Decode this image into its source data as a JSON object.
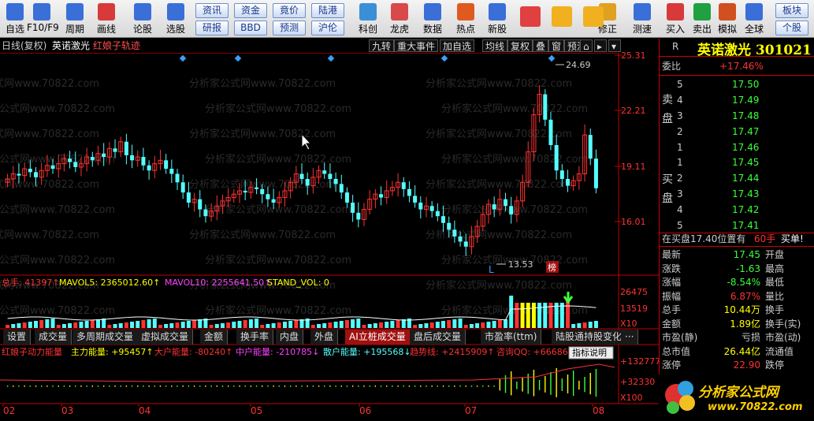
{
  "toolbar": {
    "buttons": [
      {
        "label": "自选",
        "icon": "watchlist-icon"
      },
      {
        "label": "F10/F9",
        "icon": "f10-icon"
      },
      {
        "label": "周期",
        "icon": "cycle-icon"
      },
      {
        "label": "画线",
        "icon": "draw-line-icon"
      },
      {
        "label": "论股",
        "icon": "forum-icon"
      },
      {
        "label": "选股",
        "icon": "stock-picker-icon"
      },
      {
        "label": "科创",
        "icon": "sci-tech-icon"
      },
      {
        "label": "龙虎",
        "icon": "dragon-tiger-icon"
      },
      {
        "label": "数据",
        "icon": "data-icon"
      },
      {
        "label": "热点",
        "icon": "hotspot-icon"
      },
      {
        "label": "新股",
        "icon": "ipo-icon"
      },
      {
        "label": "修正",
        "icon": "revise-icon"
      },
      {
        "label": "测速",
        "icon": "speed-test-icon"
      },
      {
        "label": "买入",
        "icon": "buy-icon"
      },
      {
        "label": "卖出",
        "icon": "sell-icon"
      },
      {
        "label": "模拟",
        "icon": "simulate-icon"
      },
      {
        "label": "全球",
        "icon": "global-icon"
      }
    ],
    "small_buttons": [
      "资讯",
      "资金",
      "竟价",
      "陆港",
      "研报",
      "BBD",
      "预测",
      "沪伦"
    ],
    "right_buttons": [
      "板块",
      "个股"
    ]
  },
  "chart_header": {
    "title": "日线(复权)",
    "stock_name": "英诺激光",
    "indicator": "红娘子轨迹",
    "buttons": [
      "九转",
      "重大事件",
      "加自选",
      "均线",
      "复权",
      "叠",
      "窗",
      "预测"
    ]
  },
  "price_axis": [
    "25.31",
    "22.21",
    "19.11",
    "16.01"
  ],
  "annotations": {
    "high": "24.69",
    "low": "13.53",
    "low_mark": "L",
    "badge": "榜"
  },
  "volume_header": {
    "total": "总手: 41397↑",
    "mavol5": "MAVOL5: 2365012.60↑",
    "mavol10": "MAVOL10: 2255641.50↑",
    "stand": "STAND_VOL: 0"
  },
  "volume_axis": [
    "26475",
    "13519",
    "X10"
  ],
  "tabs": [
    "设置",
    "成交量",
    "多周期成交量",
    "虚拟成交量",
    "金额",
    "换手率",
    "内盘",
    "外盘",
    "AI立桩成交量",
    "盘后成交量",
    "市盈率(ttm)",
    "陆股通持股变化",
    "···"
  ],
  "active_tab": 8,
  "indicator_header": {
    "name": "红娘子动力能量",
    "main": "主力能量: +95457↑",
    "big": "大户能量: -80240↑",
    "mid": "中户能量: -210785↓",
    "retail": "散户能量: +195568↓",
    "trend": "趋势线: +2415909↑",
    "qq": "咨询QQ: +66686",
    "explain": "指标说明"
  },
  "indicator_axis": [
    "+132777",
    "+32330",
    "X100"
  ],
  "months": [
    "02",
    "03",
    "04",
    "05",
    "06",
    "07",
    "08"
  ],
  "watermark": "分析家公式网www.70822.com",
  "quote": {
    "r_label": "R",
    "name": "英诺激光 301021",
    "weibi_label": "委比",
    "weibi_value": "+17.46%",
    "sell_label": "卖盘",
    "buy_label": "买盘",
    "sell": [
      {
        "level": "5",
        "price": "17.50"
      },
      {
        "level": "4",
        "price": "17.49"
      },
      {
        "level": "3",
        "price": "17.48"
      },
      {
        "level": "2",
        "price": "17.47"
      },
      {
        "level": "1",
        "price": "17.46"
      }
    ],
    "buy": [
      {
        "level": "1",
        "price": "17.45"
      },
      {
        "level": "2",
        "price": "17.44"
      },
      {
        "level": "3",
        "price": "17.43"
      },
      {
        "level": "4",
        "price": "17.42"
      },
      {
        "level": "5",
        "price": "17.41"
      }
    ],
    "notice": "在买盘17.40位置有",
    "notice_qty": "60手",
    "notice_action": "买单!",
    "stats": [
      {
        "l1": "最新",
        "v1": "17.45",
        "l2": "开盘"
      },
      {
        "l1": "涨跌",
        "v1": "-1.63",
        "l2": "最高"
      },
      {
        "l1": "涨幅",
        "v1": "-8.54%",
        "l2": "最低"
      },
      {
        "l1": "振幅",
        "v1": "6.87%",
        "l2": "量比"
      },
      {
        "l1": "总手",
        "v1": "10.44万",
        "l2": "换手"
      },
      {
        "l1": "金额",
        "v1": "1.89亿",
        "l2": "换手(实)"
      },
      {
        "l1": "市盈(静)",
        "v1": "亏损",
        "l2": "市盈(动)"
      },
      {
        "l1": "总市值",
        "v1": "26.44亿",
        "l2": "流通值"
      },
      {
        "l1": "涨停",
        "v1": "22.90",
        "l2": "跌停"
      }
    ]
  },
  "logo": {
    "title": "分析家公式网",
    "url": "www.70822.com"
  },
  "colors": {
    "up": "#ff3232",
    "down": "#54ffff",
    "accent": "#ffff00",
    "panel_border": "#c00000"
  }
}
